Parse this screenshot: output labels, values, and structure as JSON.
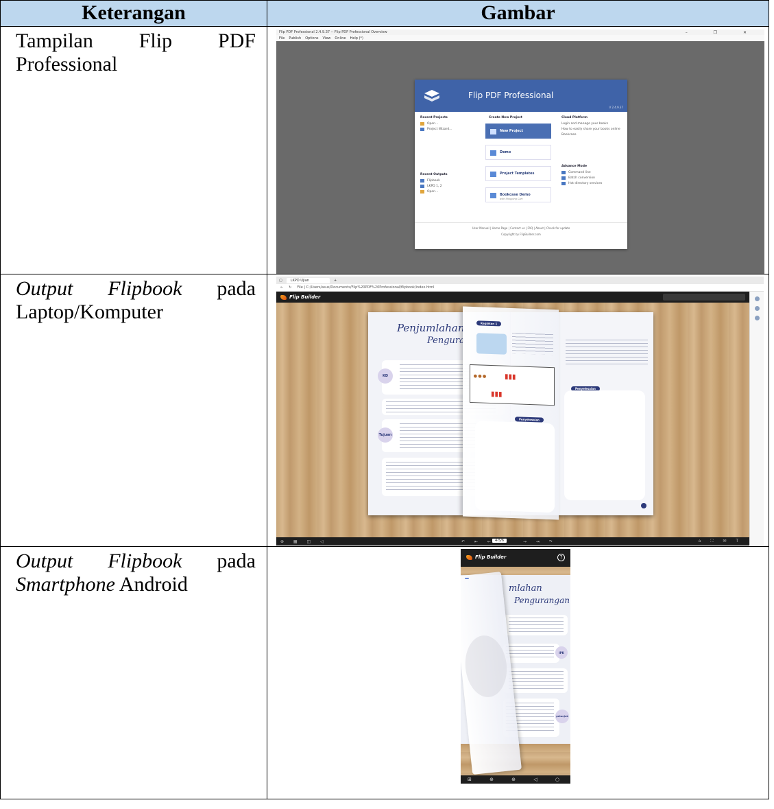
{
  "table": {
    "header_keterangan": "Keterangan",
    "header_gambar": "Gambar"
  },
  "rows": [
    {
      "desc_word1": "Tampilan",
      "desc_word2": "Flip",
      "desc_word3": "PDF",
      "desc_line2": "Professional"
    },
    {
      "desc_italic1": "Output",
      "desc_italic2": "Flipbook",
      "desc_word3": "pada",
      "desc_line2": "Laptop/Komputer"
    },
    {
      "desc_italic1": "Output",
      "desc_italic2": "Flipbook",
      "desc_word3": "pada",
      "desc_line2_italic": "Smartphone",
      "desc_line2_rest": " Android"
    }
  ],
  "screenshot1": {
    "title_bar": "Flip PDF Professional 2.4.9.37 -- Flip PDF Professional Overview",
    "menu": [
      "File",
      "Publish",
      "Options",
      "View",
      "Online",
      "Help (*)"
    ],
    "window_controls": "– ❐ ✕",
    "dialog_title": "Flip PDF Professional",
    "version": "V 2.4.9.37",
    "recent_projects": {
      "heading": "Recent Projects",
      "items": [
        "Open...",
        "Project Wizard..."
      ]
    },
    "recent_outputs": {
      "heading": "Recent Outputs",
      "items": [
        "Flipbook",
        "LKPD 1, 2",
        "Open..."
      ]
    },
    "create_new": {
      "heading": "Create New Project",
      "new_project": "New Project",
      "demo": "Demo",
      "templates": "Project Templates",
      "bookcase": "Bookcase Demo",
      "bookcase_sub": "with Shopping Cart"
    },
    "cloud": {
      "heading": "Cloud Platform",
      "items": [
        "Login and manage your books",
        "How to easily share your books online",
        "Bookcase"
      ]
    },
    "advance": {
      "heading": "Advance Mode",
      "items": [
        "Command line",
        "Batch conversion",
        "Hot directory services"
      ]
    },
    "footer_links": "User Manual  |  Home Page  |  Contact us  |  FAQ  |  About  |  Check for update",
    "copyright": "Copyright by FlipBuilder.com"
  },
  "screenshot2": {
    "tab_title": "LKPD Ujian",
    "url": "File  |  C:/Users/asus/Documents/Flip%20PDF%20Professional/flipbook/index.html",
    "brand": "Flip Builder",
    "page_title_1": "Penjumlahan",
    "page_title_2": "Pengura",
    "badge_latihan": "Kegiatan 1",
    "badge_penyelesaian": "Penyelesaian",
    "circle_kd": "KD",
    "circle_tujuan": "Tujuan",
    "page_indicator": "4-5/6"
  },
  "screenshot3": {
    "brand": "Flip Builder",
    "help": "?",
    "title_1": "mlahan",
    "title_2": "Pengurangan",
    "circle_ipk": "IPK",
    "circle_petunjuk": "petunjuk",
    "bottom_icons": "⊞ ⊕ ⊕ ◁ ○ ⊖"
  },
  "icons": [
    "folder-icon",
    "document-icon",
    "flipbook-icon",
    "search-icon",
    "help-icon",
    "grid-icon",
    "zoom-icon",
    "sound-icon",
    "arrow-icon"
  ],
  "colors": {
    "header_fill": "#bdd7ee",
    "dialog_blue": "#3f63a8",
    "flipbook_dark": "#1e1e1e",
    "wood": "#cfae82",
    "accent_navy": "#2d3a7a"
  }
}
